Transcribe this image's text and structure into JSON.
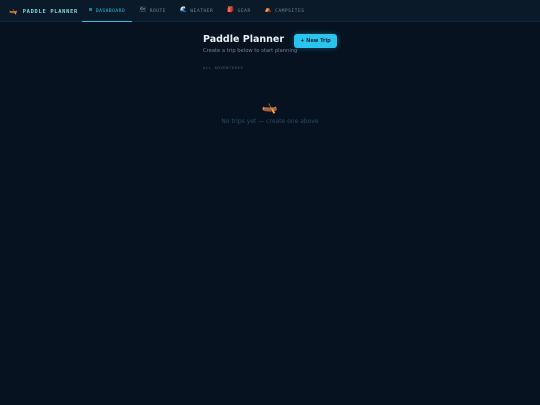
{
  "brand": {
    "name": "PADDLE PLANNER",
    "icon": "canoe-icon",
    "glyph": "🛶"
  },
  "nav": [
    {
      "label": "DASHBOARD",
      "icon": "grid-icon",
      "glyph": "⊞",
      "active": true
    },
    {
      "label": "ROUTE",
      "icon": "map-icon",
      "glyph": "🗺",
      "active": false
    },
    {
      "label": "WEATHER",
      "icon": "weather-icon",
      "glyph": "🌊",
      "active": false
    },
    {
      "label": "GEAR",
      "icon": "backpack-icon",
      "glyph": "🎒",
      "active": false
    },
    {
      "label": "CAMPSITES",
      "icon": "tent-icon",
      "glyph": "⛺",
      "active": false
    }
  ],
  "header": {
    "title": "Paddle Planner",
    "subtitle": "Create a trip below to start planning"
  },
  "actions": {
    "new_trip_label": "+ New Trip"
  },
  "section": {
    "label": "ALL ADVENTURES"
  },
  "empty_state": {
    "icon": "canoe-icon",
    "glyph": "🛶",
    "text": "No trips yet — create one above"
  },
  "colors": {
    "accent": "#29c5ee",
    "background": "#061220",
    "topbar": "#0b1a28"
  }
}
